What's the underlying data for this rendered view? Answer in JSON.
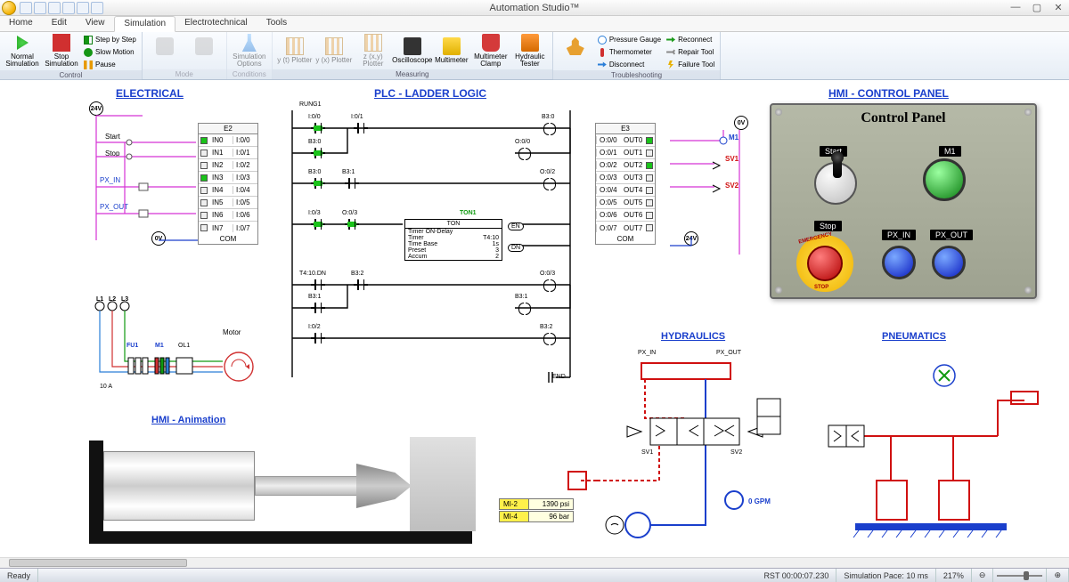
{
  "titlebar": {
    "title": "Automation Studio™"
  },
  "tabs": [
    "Home",
    "Edit",
    "View",
    "Simulation",
    "Electrotechnical",
    "Tools"
  ],
  "activeTab": "Simulation",
  "ribbon": {
    "control": {
      "label": "Control",
      "normal": "Normal Simulation",
      "stop": "Stop Simulation",
      "step": "Step by Step",
      "slow": "Slow Motion",
      "pause": "Pause"
    },
    "mode": {
      "label": "Mode"
    },
    "conditions": {
      "label": "Conditions",
      "simopt": "Simulation Options"
    },
    "measuring": {
      "label": "Measuring",
      "yt": "y (t) Plotter",
      "yx": "y (x) Plotter",
      "zxy": "z (x,y) Plotter",
      "osc": "Oscilloscope",
      "mm": "Multimeter",
      "clamp": "Multimeter Clamp",
      "ht": "Hydraulic Tester"
    },
    "trouble": {
      "label": "Troubleshooting",
      "man": "",
      "pg": "Pressure Gauge",
      "th": "Thermometer",
      "dc": "Disconnect",
      "rc": "Reconnect",
      "rt": "Repair Tool",
      "ft": "Failure Tool"
    }
  },
  "sections": {
    "electrical": "ELECTRICAL",
    "plc": "PLC - LADDER LOGIC",
    "hmi_panel": "HMI  - CONTROL PANEL",
    "hmi_anim": "HMI - Animation",
    "hyd": "HYDRAULICS",
    "pneu": "PNEUMATICS"
  },
  "electrical": {
    "v24": "24V",
    "v0": "0V",
    "start": "Start",
    "stop": "Stop",
    "pxin": "PX_IN",
    "pxout": "PX_OUT",
    "e2": {
      "name": "E2",
      "rows": [
        {
          "led": true,
          "lbl": "IN0",
          "addr": "I:0/0"
        },
        {
          "led": false,
          "lbl": "IN1",
          "addr": "I:0/1"
        },
        {
          "led": false,
          "lbl": "IN2",
          "addr": "I:0/2"
        },
        {
          "led": true,
          "lbl": "IN3",
          "addr": "I:0/3"
        },
        {
          "led": false,
          "lbl": "IN4",
          "addr": "I:0/4"
        },
        {
          "led": false,
          "lbl": "IN5",
          "addr": "I:0/5"
        },
        {
          "led": false,
          "lbl": "IN6",
          "addr": "I:0/6"
        },
        {
          "led": false,
          "lbl": "IN7",
          "addr": "I:0/7"
        }
      ],
      "com": "COM"
    },
    "e3": {
      "name": "E3",
      "rows": [
        {
          "led": true,
          "lbl": "OUT0",
          "addr": "O:0/0"
        },
        {
          "led": false,
          "lbl": "OUT1",
          "addr": "O:0/1"
        },
        {
          "led": true,
          "lbl": "OUT2",
          "addr": "O:0/2"
        },
        {
          "led": false,
          "lbl": "OUT3",
          "addr": "O:0/3"
        },
        {
          "led": false,
          "lbl": "OUT4",
          "addr": "O:0/4"
        },
        {
          "led": false,
          "lbl": "OUT5",
          "addr": "O:0/5"
        },
        {
          "led": false,
          "lbl": "OUT6",
          "addr": "O:0/6"
        },
        {
          "led": false,
          "lbl": "OUT7",
          "addr": "O:0/7"
        }
      ],
      "com": "COM"
    },
    "out_lbls": {
      "m1": "M1",
      "sv1": "SV1",
      "sv2": "SV2"
    },
    "motor": {
      "l1": "L1",
      "l2": "L2",
      "l3": "L3",
      "fu1": "FU1",
      "m1": "M1",
      "ol1": "OL1",
      "amp": "10 A",
      "motor": "Motor"
    }
  },
  "plc": {
    "rung1": "RUNG1",
    "labels": {
      "i00": "I:0/0",
      "i01": "I:0/1",
      "b30": "B3:0",
      "o00": "O:0/0",
      "b31": "B3:1",
      "o02": "O:0/2",
      "i03": "I:0/3",
      "o03": "O:0/3",
      "t410dn": "T4:10.DN",
      "b32": "B3:2",
      "i02": "I:0/2",
      "ton_name": "TON1",
      "end": "END"
    },
    "ton": {
      "hdr": "TON",
      "l1": "Timer ON-Delay",
      "r": [
        {
          "k": "Timer",
          "v": "T4:10"
        },
        {
          "k": "Time Base",
          "v": "1s"
        },
        {
          "k": "Preset",
          "v": "3"
        },
        {
          "k": "Accum",
          "v": "2"
        }
      ],
      "en": "EN",
      "dn": "DN"
    }
  },
  "hmi": {
    "title": "Control Panel",
    "start": "Start",
    "m1": "M1",
    "stop": "Stop",
    "pxin": "PX_IN",
    "pxout": "PX_OUT",
    "estop_top": "EMERGENCY",
    "estop_bot": "STOP"
  },
  "hyd": {
    "pxin": "PX_IN",
    "pxout": "PX_OUT",
    "sv1": "SV1",
    "sv2": "SV2",
    "flow": "0 GPM",
    "meas": [
      {
        "k": "MI-2",
        "v": "1390 psi"
      },
      {
        "k": "MI-4",
        "v": "96 bar"
      }
    ]
  },
  "statusbar": {
    "ready": "Ready",
    "rst": "RST 00:00:07.230",
    "pace": "Simulation Pace: 10 ms",
    "zoom": "217%"
  }
}
